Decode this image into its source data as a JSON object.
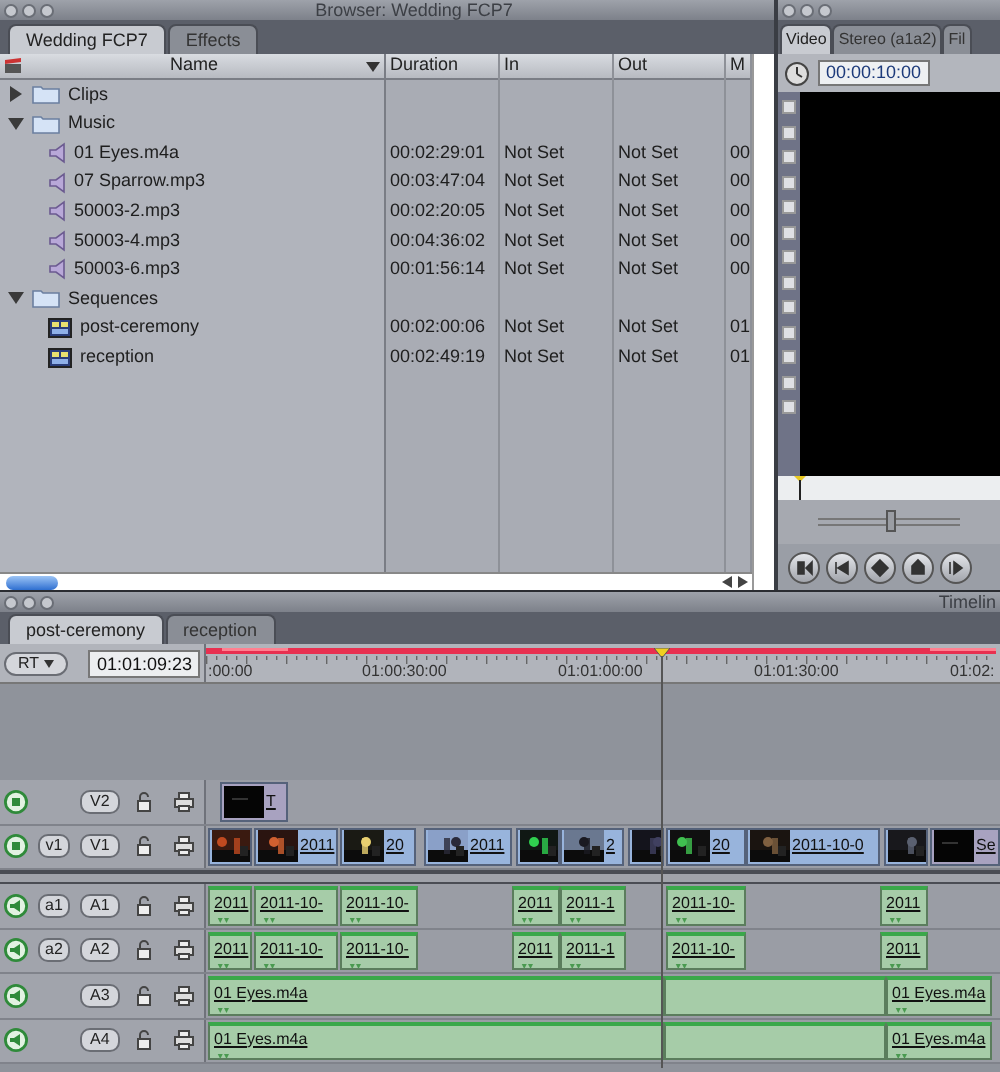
{
  "browser": {
    "title": "Browser: Wedding FCP7",
    "tabs": [
      {
        "label": "Wedding FCP7",
        "selected": true
      },
      {
        "label": "Effects",
        "selected": false
      }
    ],
    "columns": [
      "Name",
      "Duration",
      "In",
      "Out",
      "M"
    ],
    "rows": [
      {
        "kind": "folder",
        "name": "Clips",
        "expanded": false
      },
      {
        "kind": "folder",
        "name": "Music",
        "expanded": true,
        "children": [
          {
            "kind": "audio",
            "name": "01 Eyes.m4a",
            "duration": "00:02:29:01",
            "in": "Not Set",
            "out": "Not Set",
            "column_5": "00"
          },
          {
            "kind": "audio",
            "name": "07 Sparrow.mp3",
            "duration": "00:03:47:04",
            "in": "Not Set",
            "out": "Not Set",
            "column_5": "00"
          },
          {
            "kind": "audio",
            "name": "50003-2.mp3",
            "duration": "00:02:20:05",
            "in": "Not Set",
            "out": "Not Set",
            "column_5": "00"
          },
          {
            "kind": "audio",
            "name": "50003-4.mp3",
            "duration": "00:04:36:02",
            "in": "Not Set",
            "out": "Not Set",
            "column_5": "00"
          },
          {
            "kind": "audio",
            "name": "50003-6.mp3",
            "duration": "00:01:56:14",
            "in": "Not Set",
            "out": "Not Set",
            "column_5": "00"
          }
        ]
      },
      {
        "kind": "folder",
        "name": "Sequences",
        "expanded": true,
        "children": [
          {
            "kind": "sequence",
            "name": "post-ceremony",
            "duration": "00:02:00:06",
            "in": "Not Set",
            "out": "Not Set",
            "column_5": "01"
          },
          {
            "kind": "sequence",
            "name": "reception",
            "duration": "00:02:49:19",
            "in": "Not Set",
            "out": "Not Set",
            "column_5": "01"
          }
        ]
      }
    ]
  },
  "viewer": {
    "tabs": [
      {
        "label": "Video",
        "selected": true
      },
      {
        "label": "Stereo (a1a2)",
        "selected": false
      },
      {
        "label": "Fil",
        "selected": false
      }
    ],
    "timecode": "00:00:10:00",
    "jog_slider": {
      "level": 0.5
    }
  },
  "timeline": {
    "title": "Timelin",
    "tabs": [
      {
        "label": "post-ceremony",
        "selected": true
      },
      {
        "label": "reception",
        "selected": false
      }
    ],
    "rt": "RT",
    "timecode": "01:01:09:23",
    "ruler": [
      ":00:00",
      "01:00:30:00",
      "01:01:00:00",
      "01:01:30:00",
      "01:02:"
    ],
    "tracks": [
      {
        "kind": "video",
        "name": "V2",
        "clips": [
          {
            "kind": "graphic",
            "label": "T"
          }
        ]
      },
      {
        "kind": "video",
        "source": "v1",
        "name": "V1",
        "clips": [
          {
            "kind": "video"
          },
          {
            "kind": "video",
            "label": "2011"
          },
          {
            "kind": "video",
            "label": "20"
          },
          {
            "kind": "video",
            "label": "2011"
          },
          {
            "kind": "video"
          },
          {
            "kind": "video",
            "label": "2"
          },
          {
            "kind": "video"
          },
          {
            "kind": "video",
            "label": "20"
          },
          {
            "kind": "video",
            "label": "2011-10-0"
          },
          {
            "kind": "video"
          },
          {
            "kind": "graphic",
            "label": "Se"
          }
        ]
      },
      {
        "kind": "audio",
        "source": "a1",
        "name": "A1",
        "clips": [
          {
            "kind": "audio",
            "label": "2011"
          },
          {
            "kind": "audio",
            "label": "2011-10-"
          },
          {
            "kind": "audio",
            "label": "2011-10-"
          },
          {
            "kind": "audio",
            "label": "2011"
          },
          {
            "kind": "audio",
            "label": "2011-1"
          },
          {
            "kind": "audio",
            "label": "2011-10-"
          },
          {
            "kind": "audio",
            "label": "2011"
          }
        ]
      },
      {
        "kind": "audio",
        "source": "a2",
        "name": "A2",
        "clips": [
          {
            "kind": "audio",
            "label": "2011"
          },
          {
            "kind": "audio",
            "label": "2011-10-"
          },
          {
            "kind": "audio",
            "label": "2011-10-"
          },
          {
            "kind": "audio",
            "label": "2011"
          },
          {
            "kind": "audio",
            "label": "2011-1"
          },
          {
            "kind": "audio",
            "label": "2011-10-"
          },
          {
            "kind": "audio",
            "label": "2011"
          }
        ]
      },
      {
        "kind": "audio",
        "name": "A3",
        "clips": [
          {
            "kind": "audio",
            "label": "01 Eyes.m4a"
          },
          {
            "kind": "audio"
          },
          {
            "kind": "audio",
            "label": "01 Eyes.m4a"
          }
        ]
      },
      {
        "kind": "audio",
        "name": "A4",
        "clips": [
          {
            "kind": "audio",
            "label": "01 Eyes.m4a"
          },
          {
            "kind": "audio"
          },
          {
            "kind": "audio",
            "label": "01 Eyes.m4a"
          }
        ]
      }
    ]
  }
}
